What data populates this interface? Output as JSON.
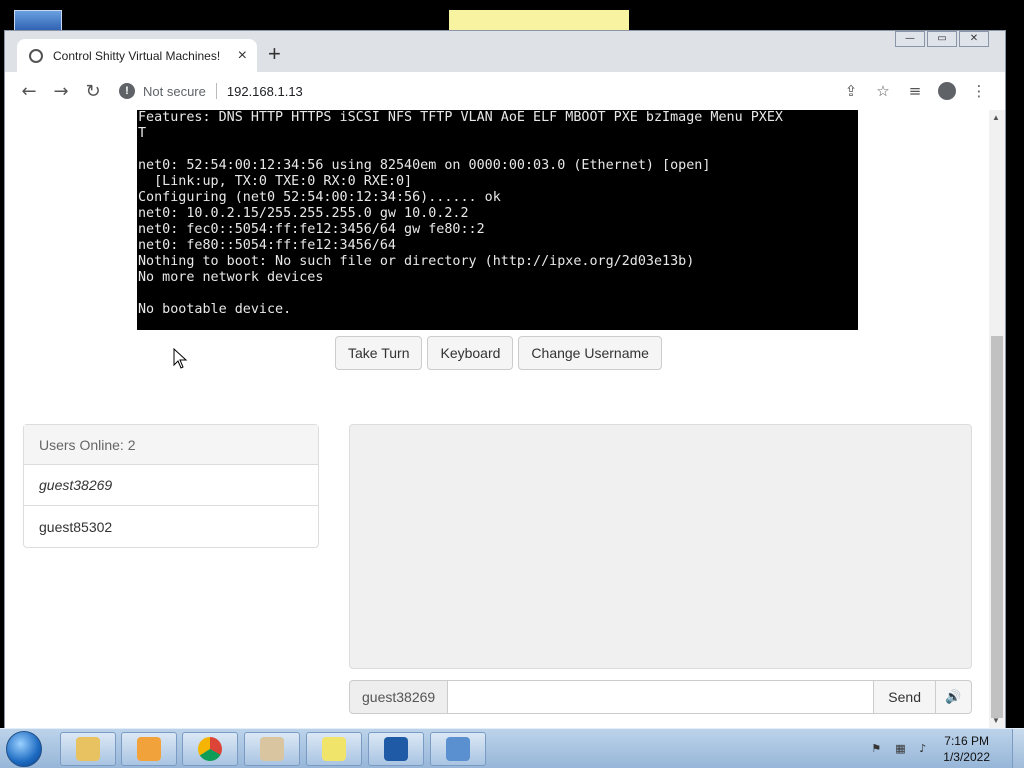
{
  "browser": {
    "tab_title": "Control Shitty Virtual Machines!",
    "tab_close": "×",
    "new_tab": "+",
    "not_secure": "Not secure",
    "url": "192.168.1.13"
  },
  "console": {
    "lines": [
      "Features: DNS HTTP HTTPS iSCSI NFS TFTP VLAN AoE ELF MBOOT PXE bzImage Menu PXEX",
      "T",
      "",
      "net0: 52:54:00:12:34:56 using 82540em on 0000:00:03.0 (Ethernet) [open]",
      "  [Link:up, TX:0 TXE:0 RX:0 RXE:0]",
      "Configuring (net0 52:54:00:12:34:56)...... ok",
      "net0: 10.0.2.15/255.255.255.0 gw 10.0.2.2",
      "net0: fec0::5054:ff:fe12:3456/64 gw fe80::2",
      "net0: fe80::5054:ff:fe12:3456/64",
      "Nothing to boot: No such file or directory (http://ipxe.org/2d03e13b)",
      "No more network devices",
      "",
      "No bootable device.",
      "_"
    ]
  },
  "actions": {
    "take_turn": "Take Turn",
    "keyboard": "Keyboard",
    "change_username": "Change Username"
  },
  "users": {
    "header": "Users Online: 2",
    "list": [
      "guest38269",
      "guest85302"
    ]
  },
  "chat": {
    "username": "guest38269",
    "input_value": "",
    "send": "Send",
    "volume_icon": "speaker-icon"
  },
  "taskbar": {
    "time": "7:16 PM",
    "date": "1/3/2022"
  }
}
